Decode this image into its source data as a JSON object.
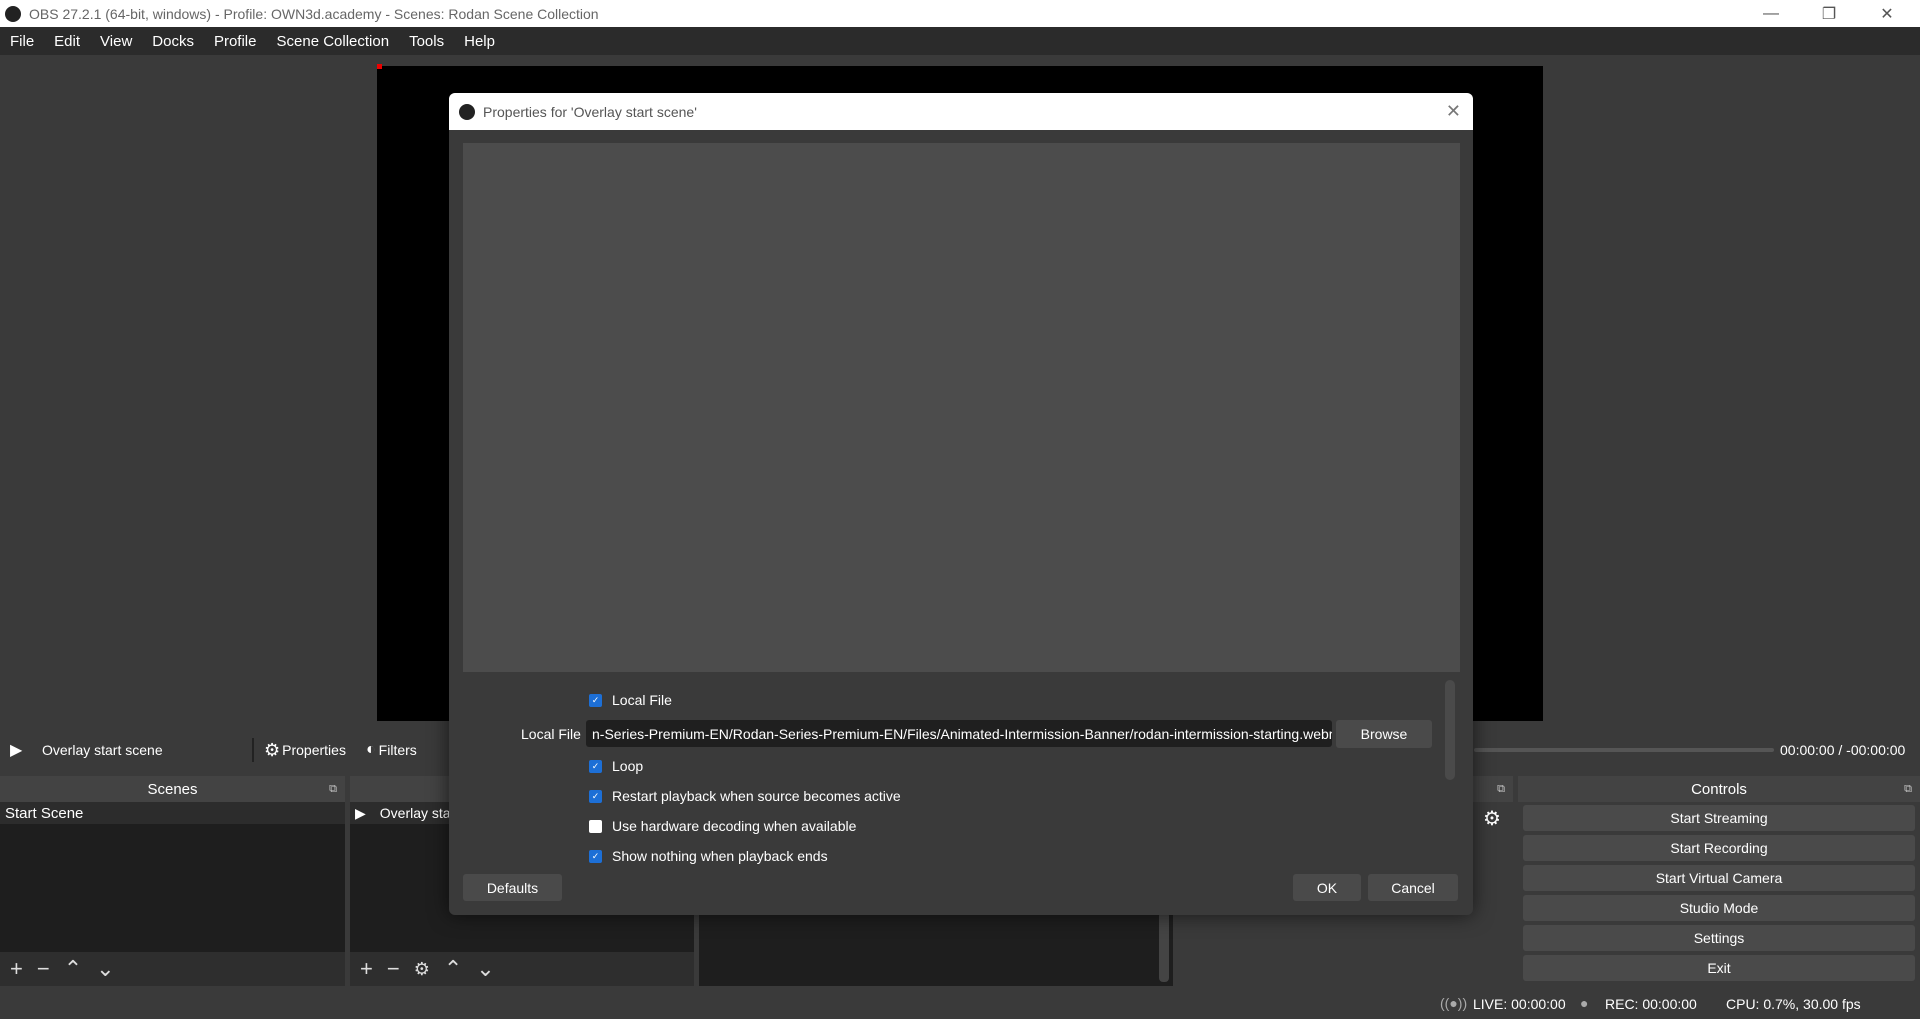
{
  "window": {
    "title": "OBS 27.2.1 (64-bit, windows) - Profile: OWN3d.academy - Scenes: Rodan Scene Collection",
    "minimize": "—",
    "maximize": "❐",
    "close": "✕"
  },
  "menu": [
    "File",
    "Edit",
    "View",
    "Docks",
    "Profile",
    "Scene Collection",
    "Tools",
    "Help"
  ],
  "toolbar": {
    "source_name": "Overlay start scene",
    "properties": "Properties",
    "filters": "Filters",
    "time": "00:00:00 / -00:00:00"
  },
  "scenes": {
    "title": "Scenes",
    "items": [
      "Start Scene"
    ]
  },
  "sources": {
    "items": [
      "Overlay start scene"
    ]
  },
  "controls": {
    "title": "Controls",
    "buttons": [
      "Start Streaming",
      "Start Recording",
      "Start Virtual Camera",
      "Studio Mode",
      "Settings",
      "Exit"
    ]
  },
  "status": {
    "live": "LIVE: 00:00:00",
    "rec": "REC: 00:00:00",
    "cpu": "CPU: 0.7%, 30.00 fps"
  },
  "dialog": {
    "title": "Properties for 'Overlay start scene'",
    "local_file_check": {
      "label": "Local File",
      "checked": true
    },
    "local_file_label": "Local File",
    "local_file_value": "n-Series-Premium-EN/Rodan-Series-Premium-EN/Files/Animated-Intermission-Banner/rodan-intermission-starting.webm",
    "browse": "Browse",
    "options": [
      {
        "label": "Loop",
        "checked": true
      },
      {
        "label": "Restart playback when source becomes active",
        "checked": true
      },
      {
        "label": "Use hardware decoding when available",
        "checked": false
      },
      {
        "label": "Show nothing when playback ends",
        "checked": true
      }
    ],
    "defaults": "Defaults",
    "ok": "OK",
    "cancel": "Cancel"
  },
  "colors": {
    "accent": "#1d6fd6",
    "background": "#3a3a3a"
  }
}
